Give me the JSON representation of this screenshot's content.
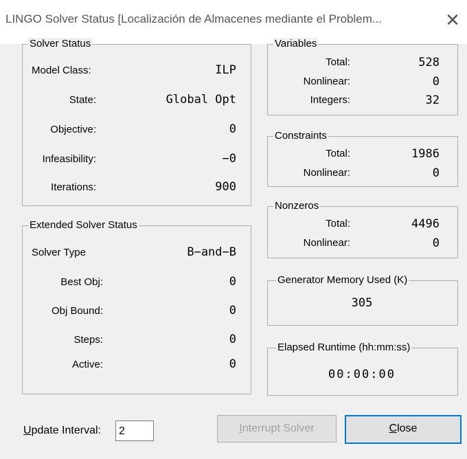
{
  "window": {
    "title": "LINGO Solver Status [Localización de Almacenes mediante el Problem...",
    "close_glyph": "✕"
  },
  "solver_status": {
    "title": "Solver Status",
    "model_class": {
      "label": "Model Class:",
      "value": "ILP"
    },
    "state": {
      "label": "State:",
      "value": "Global Opt"
    },
    "objective": {
      "label": "Objective:",
      "value": "0"
    },
    "infeasibility": {
      "label": "Infeasibility:",
      "value": "−0"
    },
    "iterations": {
      "label": "Iterations:",
      "value": "900"
    }
  },
  "extended_status": {
    "title": "Extended Solver Status",
    "solver_type": {
      "label": "Solver Type",
      "value": "B−and−B"
    },
    "best_obj": {
      "label": "Best Obj:",
      "value": "0"
    },
    "obj_bound": {
      "label": "Obj Bound:",
      "value": "0"
    },
    "steps": {
      "label": "Steps:",
      "value": "0"
    },
    "active": {
      "label": "Active:",
      "value": "0"
    }
  },
  "variables": {
    "title": "Variables",
    "total": {
      "label": "Total:",
      "value": "528"
    },
    "nonlinear": {
      "label": "Nonlinear:",
      "value": "0"
    },
    "integers": {
      "label": "Integers:",
      "value": "32"
    }
  },
  "constraints": {
    "title": "Constraints",
    "total": {
      "label": "Total:",
      "value": "1986"
    },
    "nonlinear": {
      "label": "Nonlinear:",
      "value": "0"
    }
  },
  "nonzeros": {
    "title": "Nonzeros",
    "total": {
      "label": "Total:",
      "value": "4496"
    },
    "nonlinear": {
      "label": "Nonlinear:",
      "value": "0"
    }
  },
  "memory": {
    "title": "Generator Memory Used (K)",
    "value": "305"
  },
  "runtime": {
    "title": "Elapsed Runtime (hh:mm:ss)",
    "value": "00:00:00"
  },
  "footer": {
    "update_interval_label_u": "U",
    "update_interval_label_rest": "pdate Interval:",
    "update_interval_value": "2",
    "interrupt_u": "I",
    "interrupt_rest": "nterrupt Solver",
    "close_u": "C",
    "close_rest": "lose"
  }
}
